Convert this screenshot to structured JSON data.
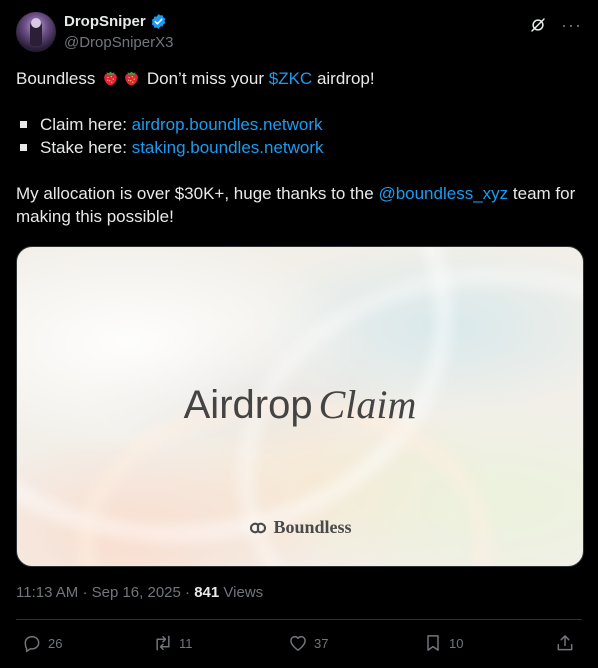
{
  "author": {
    "display_name": "DropSniper",
    "handle": "@DropSniperX3",
    "verified": true
  },
  "header": {
    "grok_icon": "grok-icon",
    "more_label": "···"
  },
  "tweet": {
    "line1": {
      "prefix": "Boundless",
      "emoji": "strawberry",
      "middle": "Don’t miss your",
      "cashtag": "$ZKC",
      "suffix": "airdrop!"
    },
    "bullets": [
      {
        "label": "Claim here:",
        "link": "airdrop.boundles.network"
      },
      {
        "label": "Stake here:",
        "link": "staking.boundles.network"
      }
    ],
    "closing": {
      "before": "My allocation is over $30K+, huge thanks to the",
      "mention": "@boundless_xyz",
      "after": "team for making this possible!"
    }
  },
  "media": {
    "title_main": "Airdrop",
    "title_italic": "Claim",
    "brand": "Boundless"
  },
  "meta": {
    "time": "11:13 AM",
    "separator": "·",
    "date": "Sep 16, 2025",
    "views_count": "841",
    "views_label": "Views"
  },
  "actions": {
    "replies": "26",
    "reposts": "11",
    "likes": "37",
    "bookmarks": "10"
  },
  "colors": {
    "background": "#000000",
    "text": "#e7e9ea",
    "muted": "#71767b",
    "link": "#1d9bf0",
    "border": "#2f3336"
  }
}
